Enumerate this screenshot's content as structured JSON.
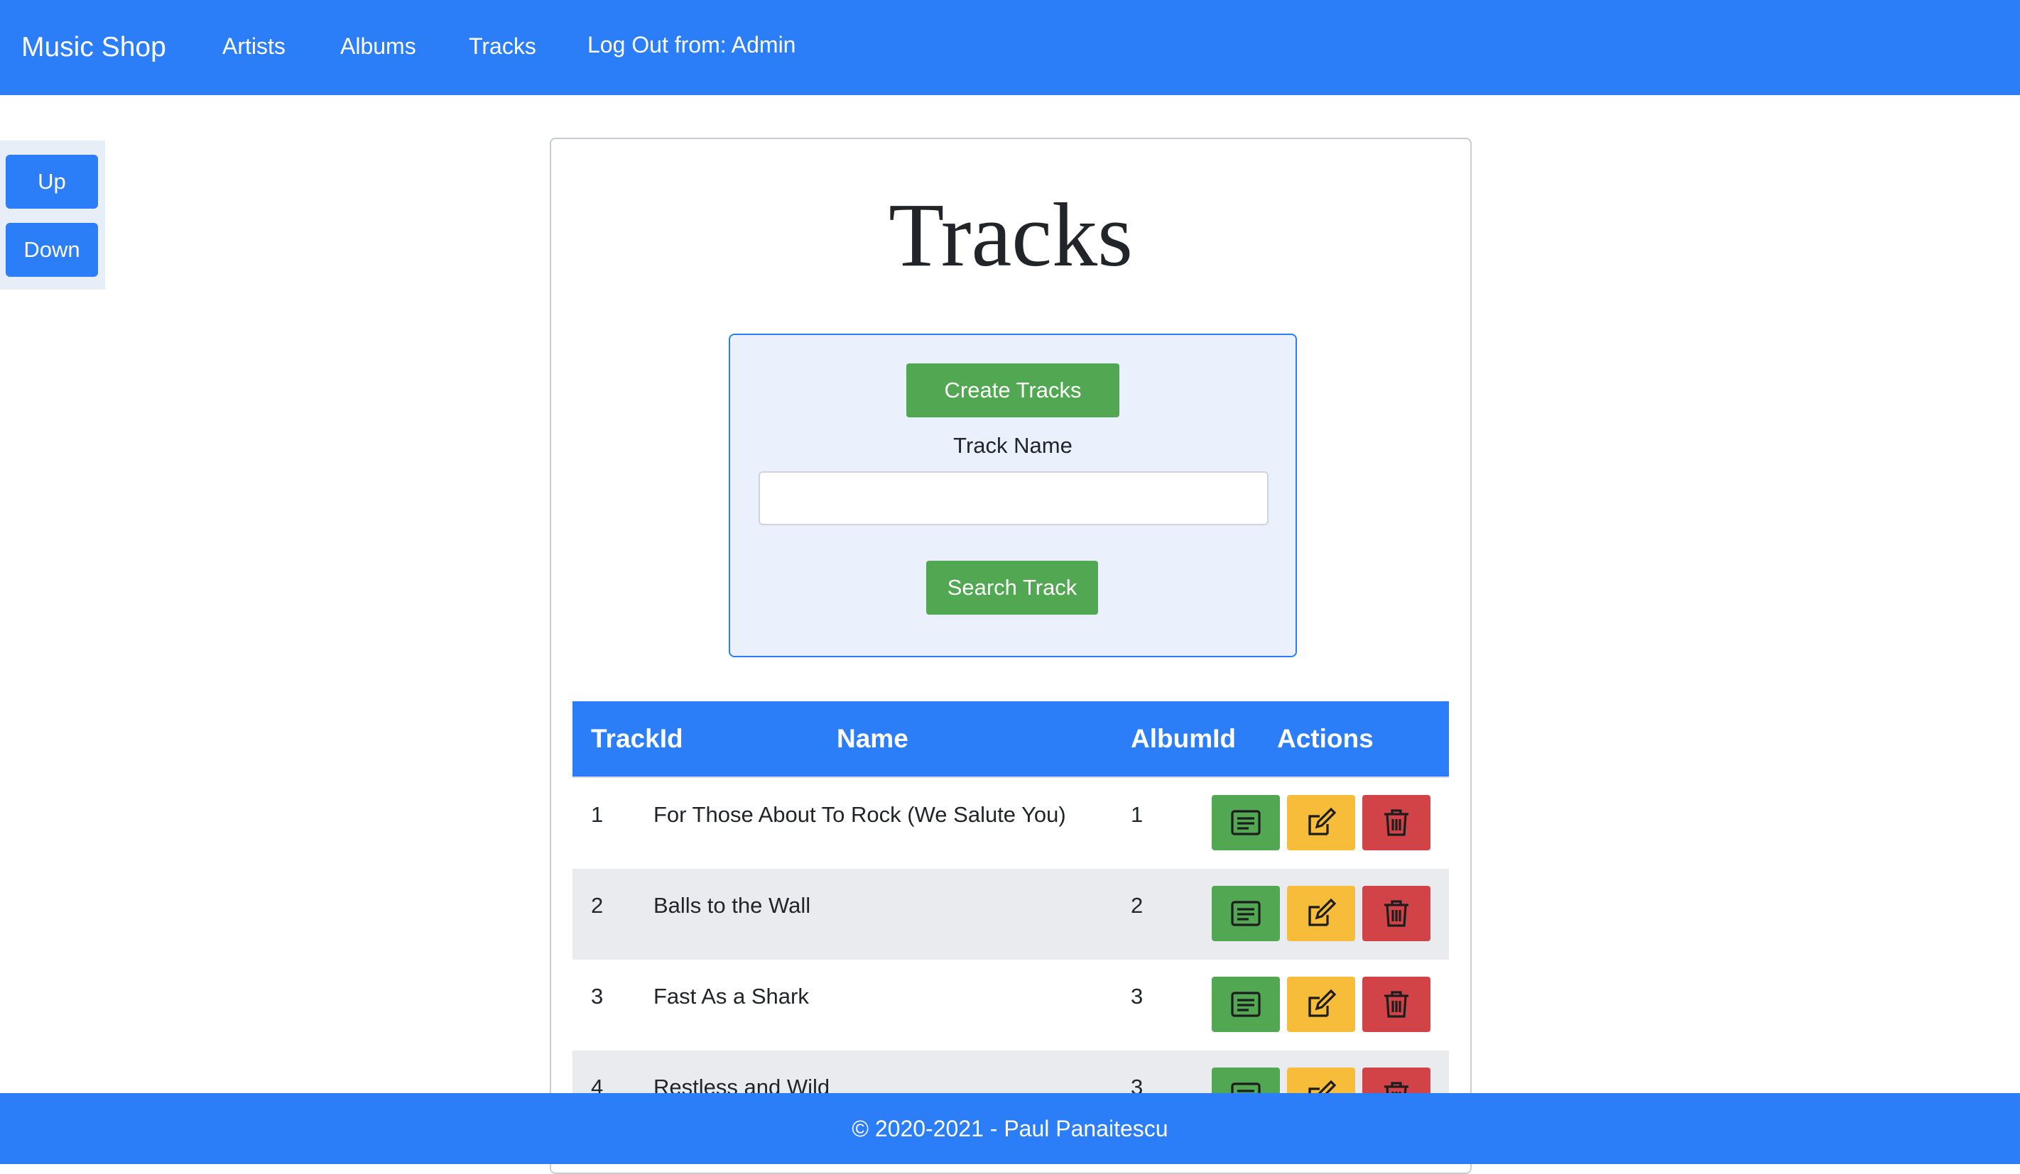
{
  "navbar": {
    "brand": "Music Shop",
    "links": [
      "Artists",
      "Albums",
      "Tracks"
    ],
    "logout": "Log Out from: Admin"
  },
  "side_panel": {
    "up_label": "Up",
    "down_label": "Down"
  },
  "page": {
    "title": "Tracks",
    "create_label": "Create Tracks",
    "field_label": "Track Name",
    "field_value": "",
    "search_label": "Search Track"
  },
  "table": {
    "headers": [
      "TrackId",
      "Name",
      "AlbumId",
      "Actions"
    ],
    "rows": [
      {
        "id": "1",
        "name": "For Those About To Rock (We Salute You)",
        "album": "1"
      },
      {
        "id": "2",
        "name": "Balls to the Wall",
        "album": "2"
      },
      {
        "id": "3",
        "name": "Fast As a Shark",
        "album": "3"
      },
      {
        "id": "4",
        "name": "Restless and Wild",
        "album": "3"
      }
    ],
    "actions": [
      "details-icon",
      "edit-icon",
      "trash-icon"
    ]
  },
  "footer": {
    "text": "© 2020-2021 - Paul Panaitescu"
  },
  "colors": {
    "primary": "#2c7ef8",
    "success": "#52a852",
    "warning": "#f7bd3a",
    "danger": "#d14347"
  }
}
